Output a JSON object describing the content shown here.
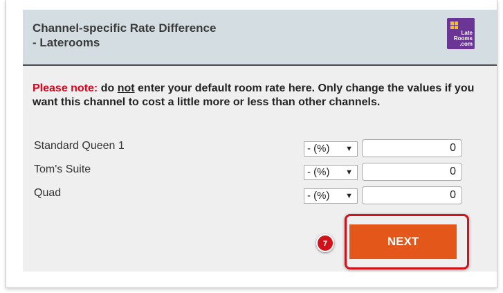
{
  "header": {
    "title_line1": "Channel-specific Rate Difference",
    "title_line2": "- Laterooms",
    "logo": {
      "line1": "Late",
      "line2": "Rooms",
      "line3": ".com"
    }
  },
  "note": {
    "label": "Please note:",
    "text_pre": " do ",
    "emphasis": "not",
    "text_post": " enter your default room rate here. Only change the values if you want this channel to cost a little more or less than other channels."
  },
  "rooms": [
    {
      "name": "Standard Queen 1",
      "adjustment": "- (%)",
      "value": "0"
    },
    {
      "name": "Tom's Suite",
      "adjustment": "- (%)",
      "value": "0"
    },
    {
      "name": "Quad",
      "adjustment": "- (%)",
      "value": "0"
    }
  ],
  "step_number": "7",
  "next_label": "NEXT",
  "colors": {
    "header_bg": "#d4dde2",
    "panel_bg": "#efefef",
    "warning_red": "#e0001b",
    "button_orange": "#e4571a",
    "highlight_red": "#d0121b",
    "logo_purple": "#6a3594"
  },
  "icons": {
    "select_arrow": "dropdown-arrow-icon",
    "logo": "laterooms-logo-icon"
  }
}
